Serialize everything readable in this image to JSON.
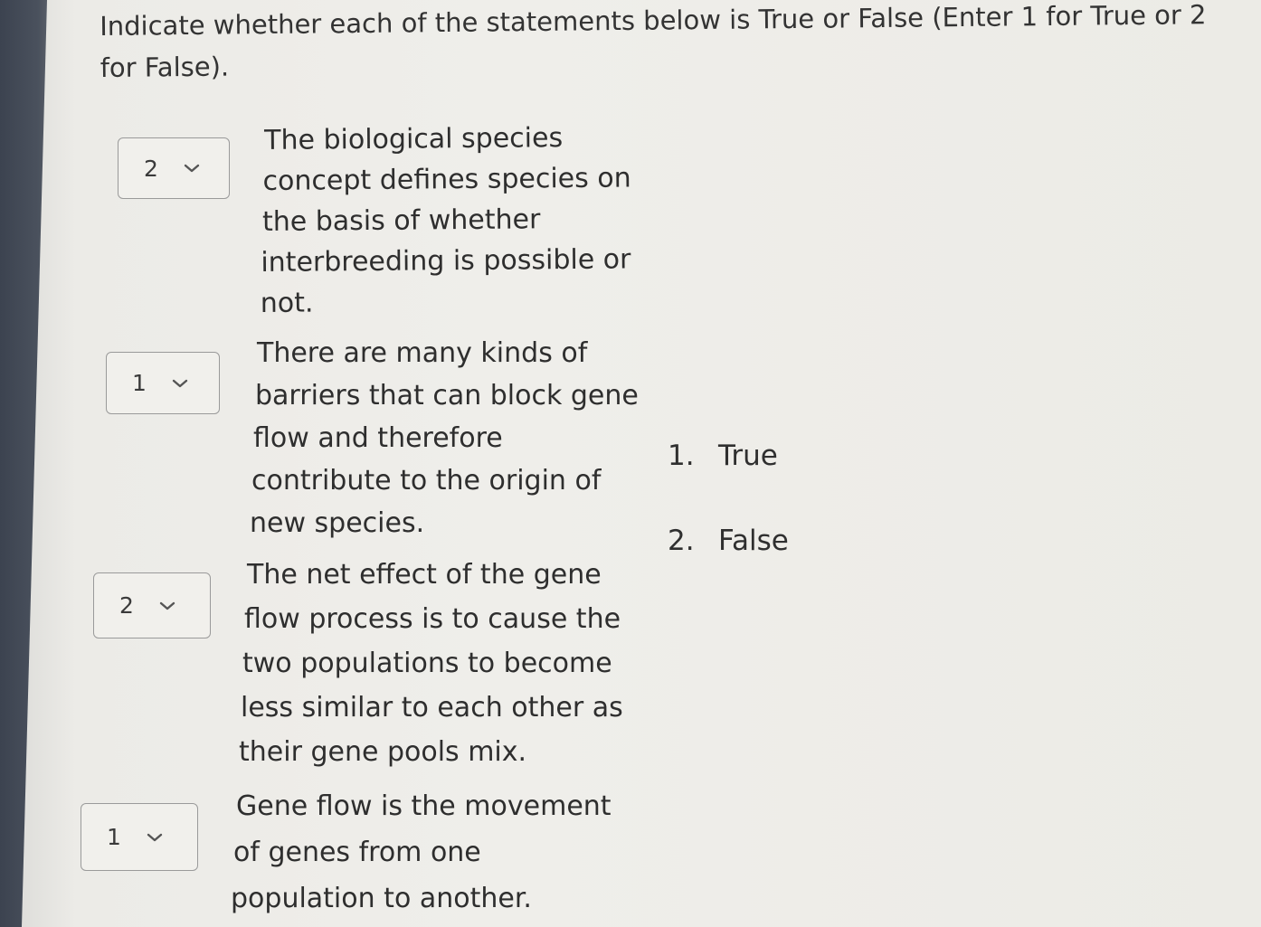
{
  "prompt": {
    "line1": "Indicate whether each of the statements below is True or False (Enter 1 for True or 2",
    "line2": "for False)."
  },
  "questions": [
    {
      "selected": "2",
      "lines": [
        "The biological species",
        "concept defines species on",
        "the basis of whether",
        "interbreeding is possible or",
        "not."
      ]
    },
    {
      "selected": "1",
      "lines": [
        "There are many kinds of",
        "barriers that can block gene",
        "flow and therefore",
        "contribute to the origin of",
        "new species."
      ]
    },
    {
      "selected": "2",
      "lines": [
        "The net effect of the gene",
        "flow process is to cause the",
        "two populations to become",
        "less similar to each other as",
        "their gene pools mix."
      ]
    },
    {
      "selected": "1",
      "lines": [
        "Gene flow is the movement",
        "of genes from one",
        "population to another."
      ]
    }
  ],
  "options": [
    {
      "num": "1.",
      "label": "True"
    },
    {
      "num": "2.",
      "label": "False"
    }
  ],
  "icons": {
    "dropdown": "chevron-down-icon"
  }
}
